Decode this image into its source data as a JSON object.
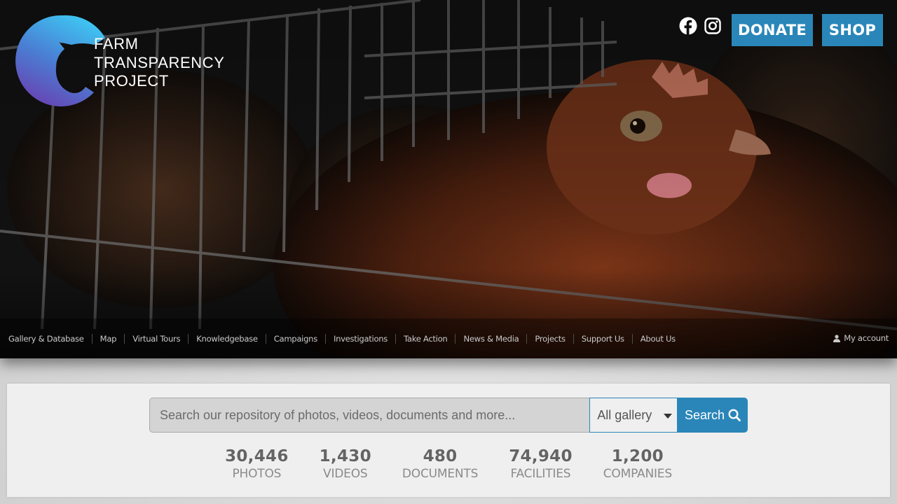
{
  "header": {
    "logo_lines": [
      "FARM",
      "TRANSPARENCY",
      "PROJECT"
    ],
    "donate_label": "DONATE",
    "shop_label": "SHOP"
  },
  "nav": {
    "items": [
      "Gallery & Database",
      "Map",
      "Virtual Tours",
      "Knowledgebase",
      "Campaigns",
      "Investigations",
      "Take Action",
      "News & Media",
      "Projects",
      "Support Us",
      "About Us"
    ],
    "account_label": "My account"
  },
  "search": {
    "placeholder": "Search our repository of photos, videos, documents and more...",
    "scope": "All gallery",
    "button_label": "Search"
  },
  "stats": [
    {
      "value": "30,446",
      "label": "PHOTOS"
    },
    {
      "value": "1,430",
      "label": "VIDEOS"
    },
    {
      "value": "480",
      "label": "DOCUMENTS"
    },
    {
      "value": "74,940",
      "label": "FACILITIES"
    },
    {
      "value": "1,200",
      "label": "COMPANIES"
    }
  ],
  "colors": {
    "accent": "#2a86b8",
    "logo_gradient_top": "#3ec6f2",
    "logo_gradient_bottom": "#6a3fb0"
  },
  "icons": {
    "facebook": "facebook-icon",
    "instagram": "instagram-icon",
    "search": "search-icon",
    "account": "user-icon"
  }
}
